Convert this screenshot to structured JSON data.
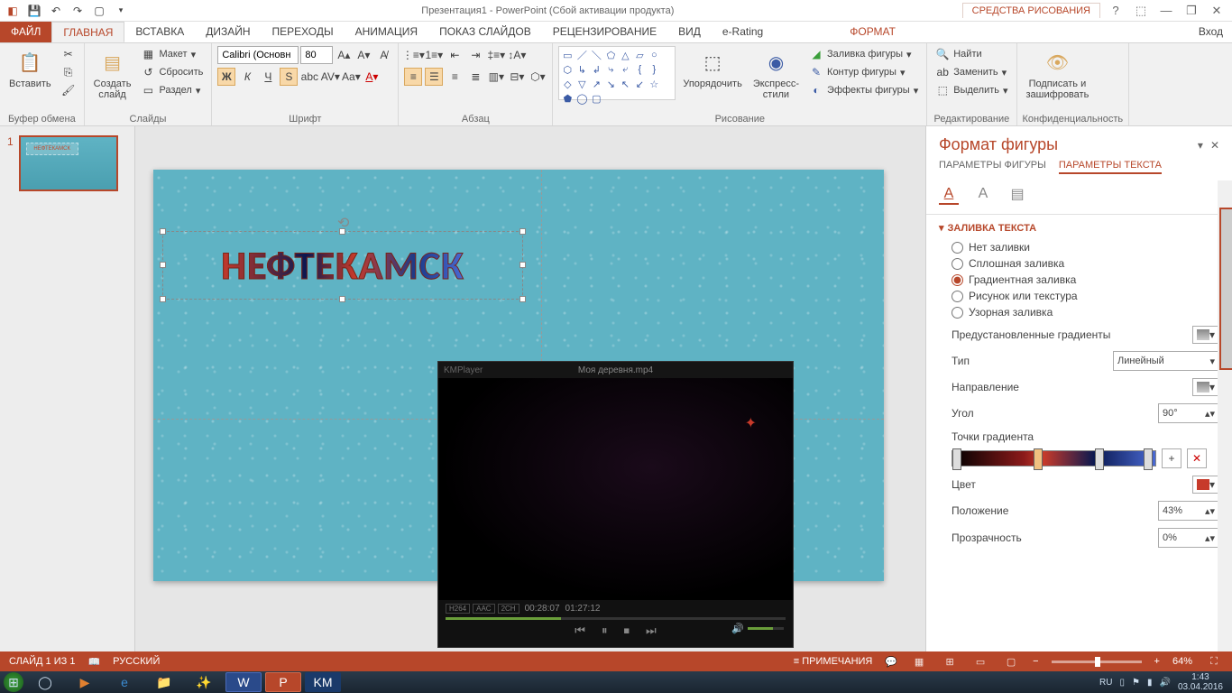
{
  "titlebar": {
    "title": "Презентация1 - PowerPoint (Сбой активации продукта)",
    "tools_context": "СРЕДСТВА РИСОВАНИЯ"
  },
  "tabs": {
    "file": "ФАЙЛ",
    "home": "ГЛАВНАЯ",
    "insert": "ВСТАВКА",
    "design": "ДИЗАЙН",
    "transitions": "ПЕРЕХОДЫ",
    "animations": "АНИМАЦИЯ",
    "slideshow": "ПОКАЗ СЛАЙДОВ",
    "review": "РЕЦЕНЗИРОВАНИЕ",
    "view": "ВИД",
    "erating": "e-Rating",
    "format": "ФОРМАТ",
    "signin": "Вход"
  },
  "ribbon": {
    "clipboard": {
      "paste": "Вставить",
      "label": "Буфер обмена"
    },
    "slides": {
      "new": "Создать\nслайд",
      "layout": "Макет",
      "reset": "Сбросить",
      "section": "Раздел",
      "label": "Слайды"
    },
    "font": {
      "name": "Calibri (Основн",
      "size": "80",
      "label": "Шрифт"
    },
    "para": {
      "label": "Абзац"
    },
    "drawing": {
      "arrange": "Упорядочить",
      "quick": "Экспресс-\nстили",
      "fill": "Заливка фигуры",
      "outline": "Контур фигуры",
      "effects": "Эффекты фигуры",
      "label": "Рисование"
    },
    "editing": {
      "find": "Найти",
      "replace": "Заменить",
      "select": "Выделить",
      "label": "Редактирование"
    },
    "irm": {
      "sign": "Подписать и\nзашифровать",
      "label": "Конфиденциальность"
    }
  },
  "slide": {
    "wordart": "НЕФТЕКАМСК",
    "number": "1"
  },
  "kmplayer": {
    "title": "Моя деревня.mp4",
    "logo": "KMPlayer",
    "elapsed": "00:28:07",
    "total": "01:27:12",
    "b1": "H264",
    "b2": "AAC",
    "b3": "2CH"
  },
  "pane": {
    "title": "Формат фигуры",
    "tab_shape": "ПАРАМЕТРЫ ФИГУРЫ",
    "tab_text": "ПАРАМЕТРЫ ТЕКСТА",
    "section": "ЗАЛИВКА ТЕКСТА",
    "fill_none": "Нет заливки",
    "fill_solid": "Сплошная заливка",
    "fill_grad": "Градиентная заливка",
    "fill_pict": "Рисунок или текстура",
    "fill_patt": "Узорная заливка",
    "preset": "Предустановленные градиенты",
    "type": "Тип",
    "type_val": "Линейный",
    "direction": "Направление",
    "angle": "Угол",
    "angle_val": "90°",
    "stops": "Точки градиента",
    "color": "Цвет",
    "position": "Положение",
    "position_val": "43%",
    "transparency": "Прозрачность",
    "transparency_val": "0%"
  },
  "status": {
    "slide": "СЛАЙД 1 ИЗ 1",
    "lang": "РУССКИЙ",
    "notes": "ПРИМЕЧАНИЯ",
    "comments": "☰",
    "zoom": "64%"
  },
  "taskbar": {
    "lang": "RU",
    "time": "1:43",
    "date": "03.04.2016"
  }
}
